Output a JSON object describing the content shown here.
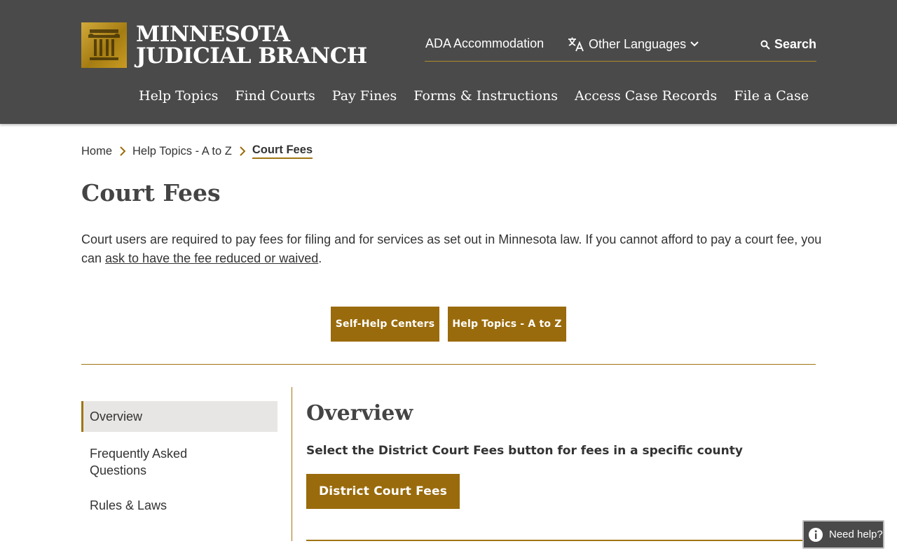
{
  "header": {
    "logo_line1": "MINNESOTA",
    "logo_line2": "JUDICIAL BRANCH",
    "ada": "ADA Accommodation",
    "languages": "Other Languages",
    "search": "Search",
    "nav": [
      "Help Topics",
      "Find Courts",
      "Pay Fines",
      "Forms & Instructions",
      "Access Case Records",
      "File a Case"
    ]
  },
  "breadcrumb": {
    "items": [
      "Home",
      "Help Topics - A to Z"
    ],
    "current": "Court Fees"
  },
  "page": {
    "title": "Court Fees",
    "intro_before": "Court users are required to pay fees for filing and for services as set out in Minnesota law.  If you cannot afford to pay a court fee, you can ",
    "intro_link": "ask to have the fee reduced or waived",
    "intro_after": ".",
    "btn_self_help": "Self-Help Centers",
    "btn_help_topics": "Help Topics - A to Z"
  },
  "sidenav": {
    "items": [
      "Overview",
      "Frequently Asked Questions",
      "Rules & Laws"
    ]
  },
  "overview": {
    "title": "Overview",
    "text": "Select the District Court Fees button for fees in a specific county",
    "button": "District Court Fees"
  },
  "help_widget": {
    "label": "Need help?"
  },
  "colors": {
    "header_bg": "#4a4a4a",
    "accent_gold": "#9a6b0c"
  }
}
